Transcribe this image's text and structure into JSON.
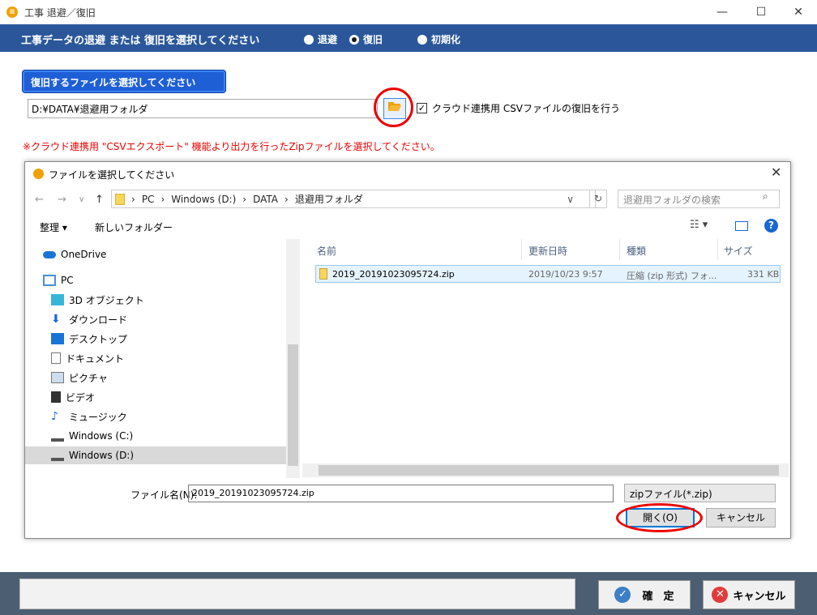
{
  "window": {
    "title": "工事 退避／復旧",
    "minimize": "—",
    "maximize": "☐",
    "close": "✕"
  },
  "mode_bar": {
    "title": "工事データの退避 または 復旧を選択してください",
    "options": [
      {
        "label": "退避",
        "selected": false
      },
      {
        "label": "復旧",
        "selected": true
      },
      {
        "label": "初期化",
        "selected": false
      }
    ]
  },
  "restore": {
    "select_label": "復旧するファイルを選択してください",
    "path_value": "D:¥DATA¥退避用フォルダ",
    "csv_check_label": "クラウド連携用 CSVファイルの復旧を行う",
    "csv_checked": true,
    "note": "※クラウド連携用 \"CSVエクスポート\" 機能より出力を行ったZipファイルを選択してください。"
  },
  "dialog": {
    "title": "ファイルを選択してください",
    "address": [
      "PC",
      "Windows (D:)",
      "DATA",
      "退避用フォルダ"
    ],
    "search_placeholder": "退避用フォルダの検索",
    "organize": "整理 ▾",
    "new_folder": "新しいフォルダー",
    "tree": [
      {
        "label": "OneDrive",
        "icon": "cloud-icon"
      },
      {
        "label": "PC",
        "icon": "pc-icon"
      },
      {
        "label": "3D オブジェクト",
        "icon": "3d-object-icon"
      },
      {
        "label": "ダウンロード",
        "icon": "download-icon"
      },
      {
        "label": "デスクトップ",
        "icon": "desktop-icon"
      },
      {
        "label": "ドキュメント",
        "icon": "document-icon"
      },
      {
        "label": "ピクチャ",
        "icon": "picture-icon"
      },
      {
        "label": "ビデオ",
        "icon": "video-icon"
      },
      {
        "label": "ミュージック",
        "icon": "music-icon"
      },
      {
        "label": "Windows  (C:)",
        "icon": "drive-icon"
      },
      {
        "label": "Windows (D:)",
        "icon": "drive-icon"
      }
    ],
    "columns": [
      "名前",
      "更新日時",
      "種類",
      "サイズ"
    ],
    "files": [
      {
        "name": "2019_20191023095724.zip",
        "modified": "2019/10/23 9:57",
        "type": "圧縮 (zip 形式) フォ...",
        "size": "331 KB"
      }
    ],
    "filename_label": "ファイル名(N):",
    "filename_value": "2019_20191023095724.zip",
    "filter": "zipファイル(*.zip)",
    "open_label": "開く(O)",
    "cancel_label": "キャンセル"
  },
  "footer": {
    "ok_label": "確　定",
    "cancel_label": "キャンセル"
  },
  "colors": {
    "accent": "#2b579a",
    "highlight_circle": "#e00000",
    "note_red": "#e00000",
    "footer_bg": "#4c5f72"
  }
}
